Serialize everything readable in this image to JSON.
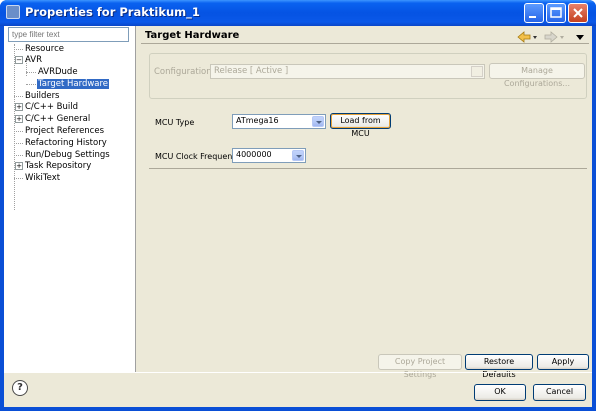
{
  "window": {
    "title": "Properties for Praktikum_1"
  },
  "filter": {
    "placeholder": "type filter text"
  },
  "tree": {
    "resource": "Resource",
    "avr": "AVR",
    "avrdude": "AVRDude",
    "target_hardware": "Target Hardware",
    "builders": "Builders",
    "cc_build": "C/C++ Build",
    "cc_general": "C/C++ General",
    "project_references": "Project References",
    "refactoring_history": "Refactoring History",
    "run_debug": "Run/Debug Settings",
    "task_repository": "Task Repository",
    "wikitext": "WikiText"
  },
  "page": {
    "title": "Target Hardware"
  },
  "config": {
    "label": "Configuration:",
    "value": "Release  [ Active ]",
    "manage_label": "Manage Configurations..."
  },
  "mcu": {
    "type_label": "MCU Type",
    "type_value": "ATmega16",
    "load_label": "Load from MCU",
    "freq_label": "MCU Clock Frequency",
    "freq_value": "4000000"
  },
  "buttons": {
    "copy_settings": "Copy Project Settings",
    "restore_defaults": "Restore Defaults",
    "apply": "Apply",
    "ok": "OK",
    "cancel": "Cancel",
    "help": "?"
  },
  "colors": {
    "titlebar": "#0553e3",
    "selection": "#316ac5",
    "dialog": "#ece9d8"
  }
}
